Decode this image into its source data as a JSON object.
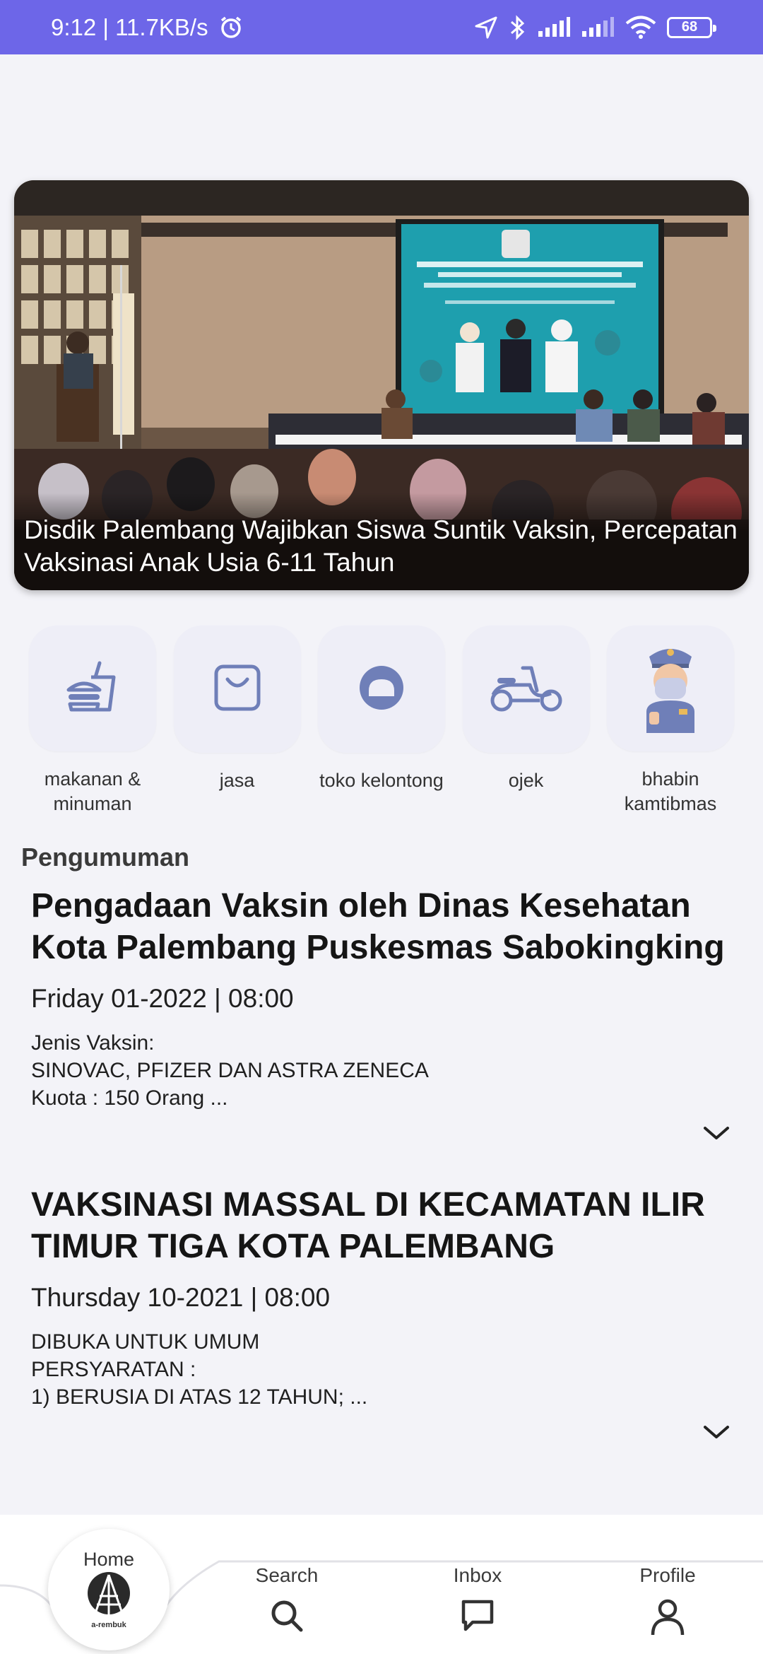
{
  "status_bar": {
    "time_speed": "9:12 | 11.7KB/s",
    "battery": "68"
  },
  "banner": {
    "caption": "Disdik Palembang Wajibkan Siswa Suntik Vaksin, Percepatan Vaksinasi Anak Usia 6-11 Tahun"
  },
  "categories": [
    {
      "label": "makanan & minuman",
      "icon": "food-icon"
    },
    {
      "label": "jasa",
      "icon": "bag-icon"
    },
    {
      "label": "toko kelontong",
      "icon": "shop-icon"
    },
    {
      "label": "ojek",
      "icon": "scooter-icon"
    },
    {
      "label": "bhabin kamtibmas",
      "icon": "police-icon"
    }
  ],
  "announcements_title": "Pengumuman",
  "announcements": [
    {
      "title": "Pengadaan Vaksin oleh Dinas Kesehatan Kota Palembang Puskesmas Sabokingking",
      "date": "Friday 01-2022 | 08:00",
      "body": "Jenis Vaksin:\nSINOVAC, PFIZER DAN ASTRA ZENECA\nKuota  : 150 Orang      ..."
    },
    {
      "title": "VAKSINASI MASSAL DI KECAMATAN ILIR TIMUR TIGA KOTA PALEMBANG",
      "date": "Thursday 10-2021 | 08:00",
      "body": "DIBUKA UNTUK UMUM\nPERSYARATAN :\n1) BERUSIA DI ATAS 12 TAHUN;      ..."
    }
  ],
  "bottom_nav": {
    "home": "Home",
    "logo_text": "a-rembuk",
    "search": "Search",
    "inbox": "Inbox",
    "profile": "Profile"
  },
  "colors": {
    "status_bar": "#6d66e8",
    "icon_accent": "#6f7fb8",
    "tile_bg": "#eeeef7"
  }
}
